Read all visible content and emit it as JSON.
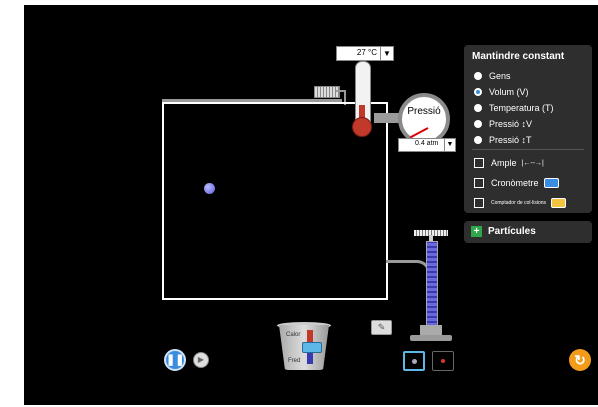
{
  "thermometer": {
    "value": "27 °C",
    "arrow": "▼"
  },
  "pressure_gauge": {
    "title": "Pressió",
    "value": "0.4 atm",
    "arrow": "▼"
  },
  "heater": {
    "hot_label": "Calor",
    "cold_label": "Fred"
  },
  "panel": {
    "title": "Mantindre constant",
    "options": [
      {
        "label": "Gens",
        "selected": false
      },
      {
        "label": "Volum (V)",
        "selected": true
      },
      {
        "label": "Temperatura (T)",
        "selected": false
      },
      {
        "label": "Pressió ↕V",
        "selected": false
      },
      {
        "label": "Pressió ↕T",
        "selected": false
      }
    ],
    "checks": [
      {
        "label": "Ample",
        "icon": "width-arrows-icon",
        "glyph": "|←--→|"
      },
      {
        "label": "Cronòmetre",
        "icon": "stopwatch-icon"
      },
      {
        "label": "Comptador de col·lisions",
        "icon": "counter-icon"
      }
    ]
  },
  "particles_panel": {
    "label": "Partícules",
    "icon": "+"
  },
  "controls": {
    "pause": "❚❚",
    "step": "▶",
    "reset": "↻",
    "eraser": "✎"
  },
  "colors": {
    "accent": "#3b8de0",
    "reset": "#f39c1a",
    "panel": "#2e2e2e",
    "plus": "#2ea84a"
  }
}
